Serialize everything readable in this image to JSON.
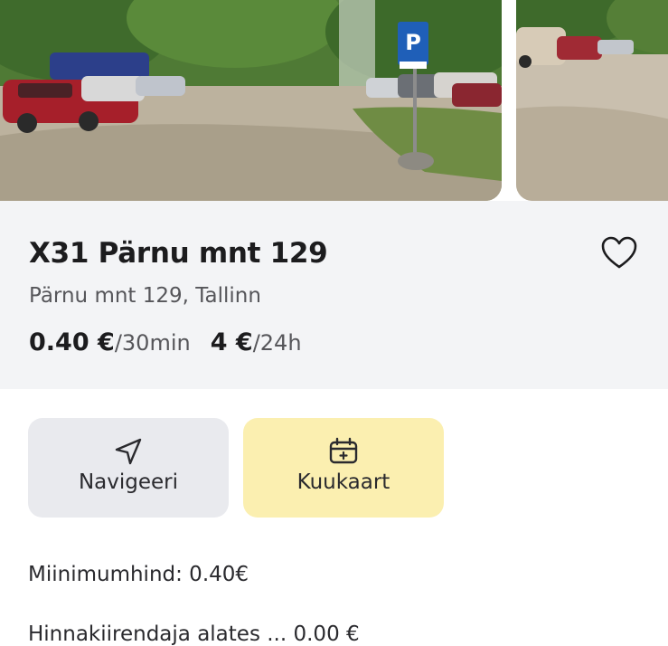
{
  "gallery": {
    "photos": [
      {
        "description_icon": "parking-lot-photo",
        "sign": "P"
      },
      {
        "description_icon": "parking-lot-photo"
      }
    ]
  },
  "zone": {
    "title": "X31 Pärnu mnt 129",
    "address": "Pärnu mnt 129, Tallinn"
  },
  "prices": [
    {
      "amount": "0.40 €",
      "unit": "/30min"
    },
    {
      "amount": "4 €",
      "unit": "/24h"
    }
  ],
  "actions": {
    "navigate_label": "Navigeeri",
    "navigate_icon": "navigation-arrow-icon",
    "monthly_label": "Kuukaart",
    "monthly_icon": "calendar-plus-icon"
  },
  "details": {
    "min_price": "Miinimumhind: 0.40€",
    "cut_off_text": "Hinnakiirendaja alates ... 0.00 €"
  },
  "colors": {
    "info_background": "#f3f4f6",
    "navigate_background": "#e9eaee",
    "monthly_background": "#fbefb0",
    "parking_sign_blue": "#1f5fb8"
  }
}
